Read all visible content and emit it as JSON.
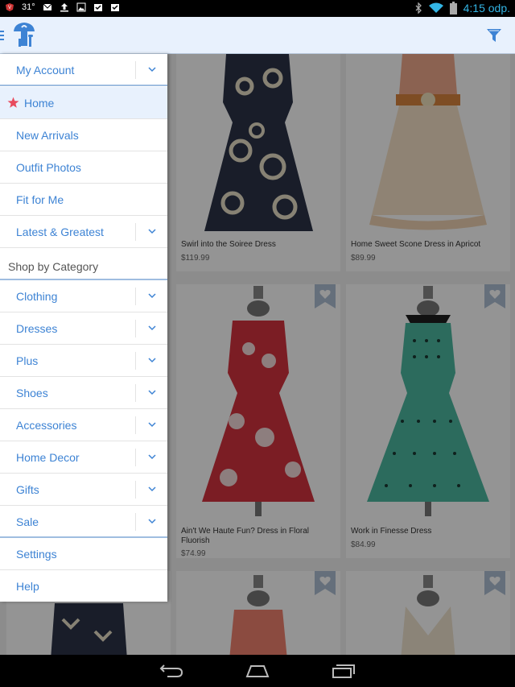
{
  "status_bar": {
    "temperature": "31°",
    "time": "4:15 odp.",
    "icons": [
      "shield-icon",
      "gmail-icon",
      "upload-icon",
      "image-icon",
      "clipboard-check-icon",
      "clipboard-check-icon",
      "bluetooth-icon",
      "wifi-icon",
      "battery-icon"
    ]
  },
  "action_bar": {
    "logo": "modcloth-logo-icon",
    "filter": "filter-icon"
  },
  "drawer": {
    "items": [
      {
        "label": "My Account",
        "expandable": true
      },
      {
        "label": "Home",
        "active": true
      },
      {
        "label": "New Arrivals"
      },
      {
        "label": "Outfit Photos"
      },
      {
        "label": "Fit for Me"
      },
      {
        "label": "Latest & Greatest",
        "expandable": true
      }
    ],
    "section_title": "Shop by Category",
    "categories": [
      {
        "label": "Clothing"
      },
      {
        "label": "Dresses"
      },
      {
        "label": "Plus"
      },
      {
        "label": "Shoes"
      },
      {
        "label": "Accessories"
      },
      {
        "label": "Home Decor"
      },
      {
        "label": "Gifts"
      },
      {
        "label": "Sale"
      }
    ],
    "footer_items": [
      {
        "label": "Settings"
      },
      {
        "label": "Help"
      }
    ]
  },
  "products": [
    {
      "title": "Swirl into the Soiree Dress",
      "price": "$119.99"
    },
    {
      "title": "Home Sweet Scone Dress in Apricot",
      "price": "$89.99"
    },
    {
      "title": "Ain't We Haute Fun? Dress in Floral Fluorish",
      "price": "$74.99"
    },
    {
      "title": "Work in Finesse Dress",
      "price": "$84.99"
    }
  ],
  "colors": {
    "accent": "#3d83d4",
    "star": "#e84b5e",
    "action_bar_bg": "#e8f1fd"
  }
}
